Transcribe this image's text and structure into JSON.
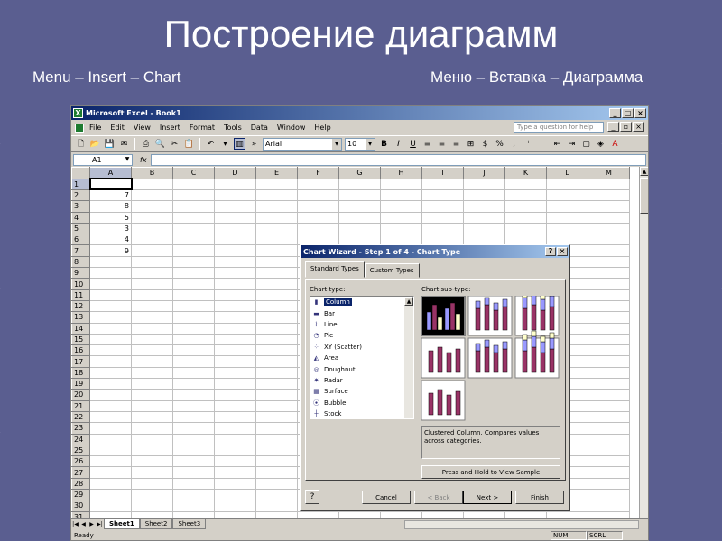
{
  "slide": {
    "title": "Построение диаграмм",
    "subtitle_left": "Menu – Insert – Chart",
    "subtitle_right": "Меню – Вставка – Диаграмма"
  },
  "excel": {
    "window_title": "Microsoft Excel - Book1",
    "menu": [
      "File",
      "Edit",
      "View",
      "Insert",
      "Format",
      "Tools",
      "Data",
      "Window",
      "Help"
    ],
    "question_placeholder": "Type a question for help",
    "font_name": "Arial",
    "font_size": "10",
    "name_box": "A1",
    "fx_label": "fx",
    "columns": [
      "A",
      "B",
      "C",
      "D",
      "E",
      "F",
      "G",
      "H",
      "I",
      "J",
      "K",
      "L",
      "M"
    ],
    "row_count": 31,
    "cells_A": [
      "",
      "7",
      "8",
      "5",
      "3",
      "4",
      "9"
    ],
    "sheets": [
      "Sheet1",
      "Sheet2",
      "Sheet3"
    ],
    "status": "Ready",
    "status_num": "NUM",
    "status_scrl": "SCRL"
  },
  "dialog": {
    "title": "Chart Wizard - Step 1 of 4 - Chart Type",
    "tabs": [
      "Standard Types",
      "Custom Types"
    ],
    "chart_type_label": "Chart type:",
    "chart_subtype_label": "Chart sub-type:",
    "chart_types": [
      {
        "label": "Column",
        "icon": "column-chart-icon",
        "glyph": "▮"
      },
      {
        "label": "Bar",
        "icon": "bar-chart-icon",
        "glyph": "▬"
      },
      {
        "label": "Line",
        "icon": "line-chart-icon",
        "glyph": "⌇"
      },
      {
        "label": "Pie",
        "icon": "pie-chart-icon",
        "glyph": "◔"
      },
      {
        "label": "XY (Scatter)",
        "icon": "scatter-chart-icon",
        "glyph": "⁘"
      },
      {
        "label": "Area",
        "icon": "area-chart-icon",
        "glyph": "◭"
      },
      {
        "label": "Doughnut",
        "icon": "doughnut-chart-icon",
        "glyph": "◎"
      },
      {
        "label": "Radar",
        "icon": "radar-chart-icon",
        "glyph": "✷"
      },
      {
        "label": "Surface",
        "icon": "surface-chart-icon",
        "glyph": "▦"
      },
      {
        "label": "Bubble",
        "icon": "bubble-chart-icon",
        "glyph": "⦿"
      },
      {
        "label": "Stock",
        "icon": "stock-chart-icon",
        "glyph": "┼"
      }
    ],
    "selected_type": "Column",
    "description": "Clustered Column. Compares values across categories.",
    "sample_button": "Press and Hold to View Sample",
    "help": "?",
    "cancel": "Cancel",
    "back": "< Back",
    "next": "Next >",
    "finish": "Finish"
  },
  "colors": {
    "slide_bg": "#5a5e90",
    "titlebar": "#0a246a",
    "chart_series_1": "#993366",
    "chart_series_2": "#9999ff",
    "chart_series_3": "#ffffcc"
  }
}
